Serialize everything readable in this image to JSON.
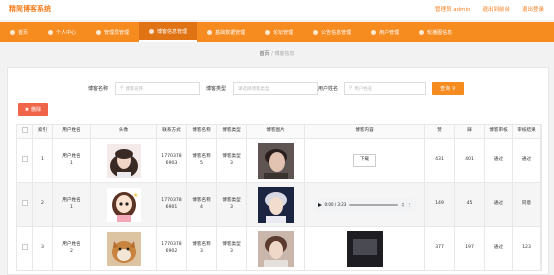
{
  "brand": "精简博客系统",
  "header_links": [
    "管理员 admin",
    "退出到前台",
    "退出登录"
  ],
  "nav": [
    {
      "label": "首页",
      "active": false
    },
    {
      "label": "个人中心",
      "active": false
    },
    {
      "label": "管理员管理",
      "active": false
    },
    {
      "label": "博客信息管理",
      "active": true
    },
    {
      "label": "基础数据管理",
      "active": false
    },
    {
      "label": "论坛管理",
      "active": false
    },
    {
      "label": "公告信息管理",
      "active": false
    },
    {
      "label": "用户管理",
      "active": false
    },
    {
      "label": "轮播图信息",
      "active": false
    }
  ],
  "breadcrumb": {
    "home": "首页",
    "sep": "/",
    "current": "博客信息"
  },
  "filters": {
    "name_label": "博客名称",
    "name_placeholder": "博客名称",
    "type_label": "博客类型",
    "type_placeholder": "请选择博客类型",
    "user_label": "用户姓名",
    "user_placeholder": "用户姓名",
    "search_label": "查询"
  },
  "delete_label": "删除",
  "columns": [
    "索引",
    "用户姓名",
    "头像",
    "联系方式",
    "博客名称",
    "博客类型",
    "博客图片",
    "博客内容",
    "赞",
    "踩",
    "博客审核",
    "审核结果"
  ],
  "rows": [
    {
      "index": "1",
      "user": "用户姓名\n1",
      "phone": "1770378\n6903",
      "name": "博客名称\n5",
      "type": "博客类型\n3",
      "content_kind": "download",
      "content_text": "下载",
      "likes": "431",
      "dislikes": "401",
      "review": "通过",
      "result": "通过"
    },
    {
      "index": "2",
      "user": "用户姓名\n1",
      "phone": "1770378\n6901",
      "name": "博客名称\n4",
      "type": "博客类型\n3",
      "content_kind": "audio",
      "content_text": "0:00 / 3:23",
      "likes": "149",
      "dislikes": "45",
      "review": "通过",
      "result": "同意"
    },
    {
      "index": "3",
      "user": "用户姓名\n2",
      "phone": "1770378\n6902",
      "name": "博客名称\n3",
      "type": "博客类型\n3",
      "content_kind": "video",
      "content_text": "",
      "likes": "377",
      "dislikes": "197",
      "review": "通过",
      "result": "123"
    }
  ],
  "colors": {
    "accent": "#f68b1f",
    "delete": "#f0644a"
  },
  "icons": {
    "nav": "circle-icon",
    "search": "search-icon",
    "delete": "trash-icon"
  }
}
